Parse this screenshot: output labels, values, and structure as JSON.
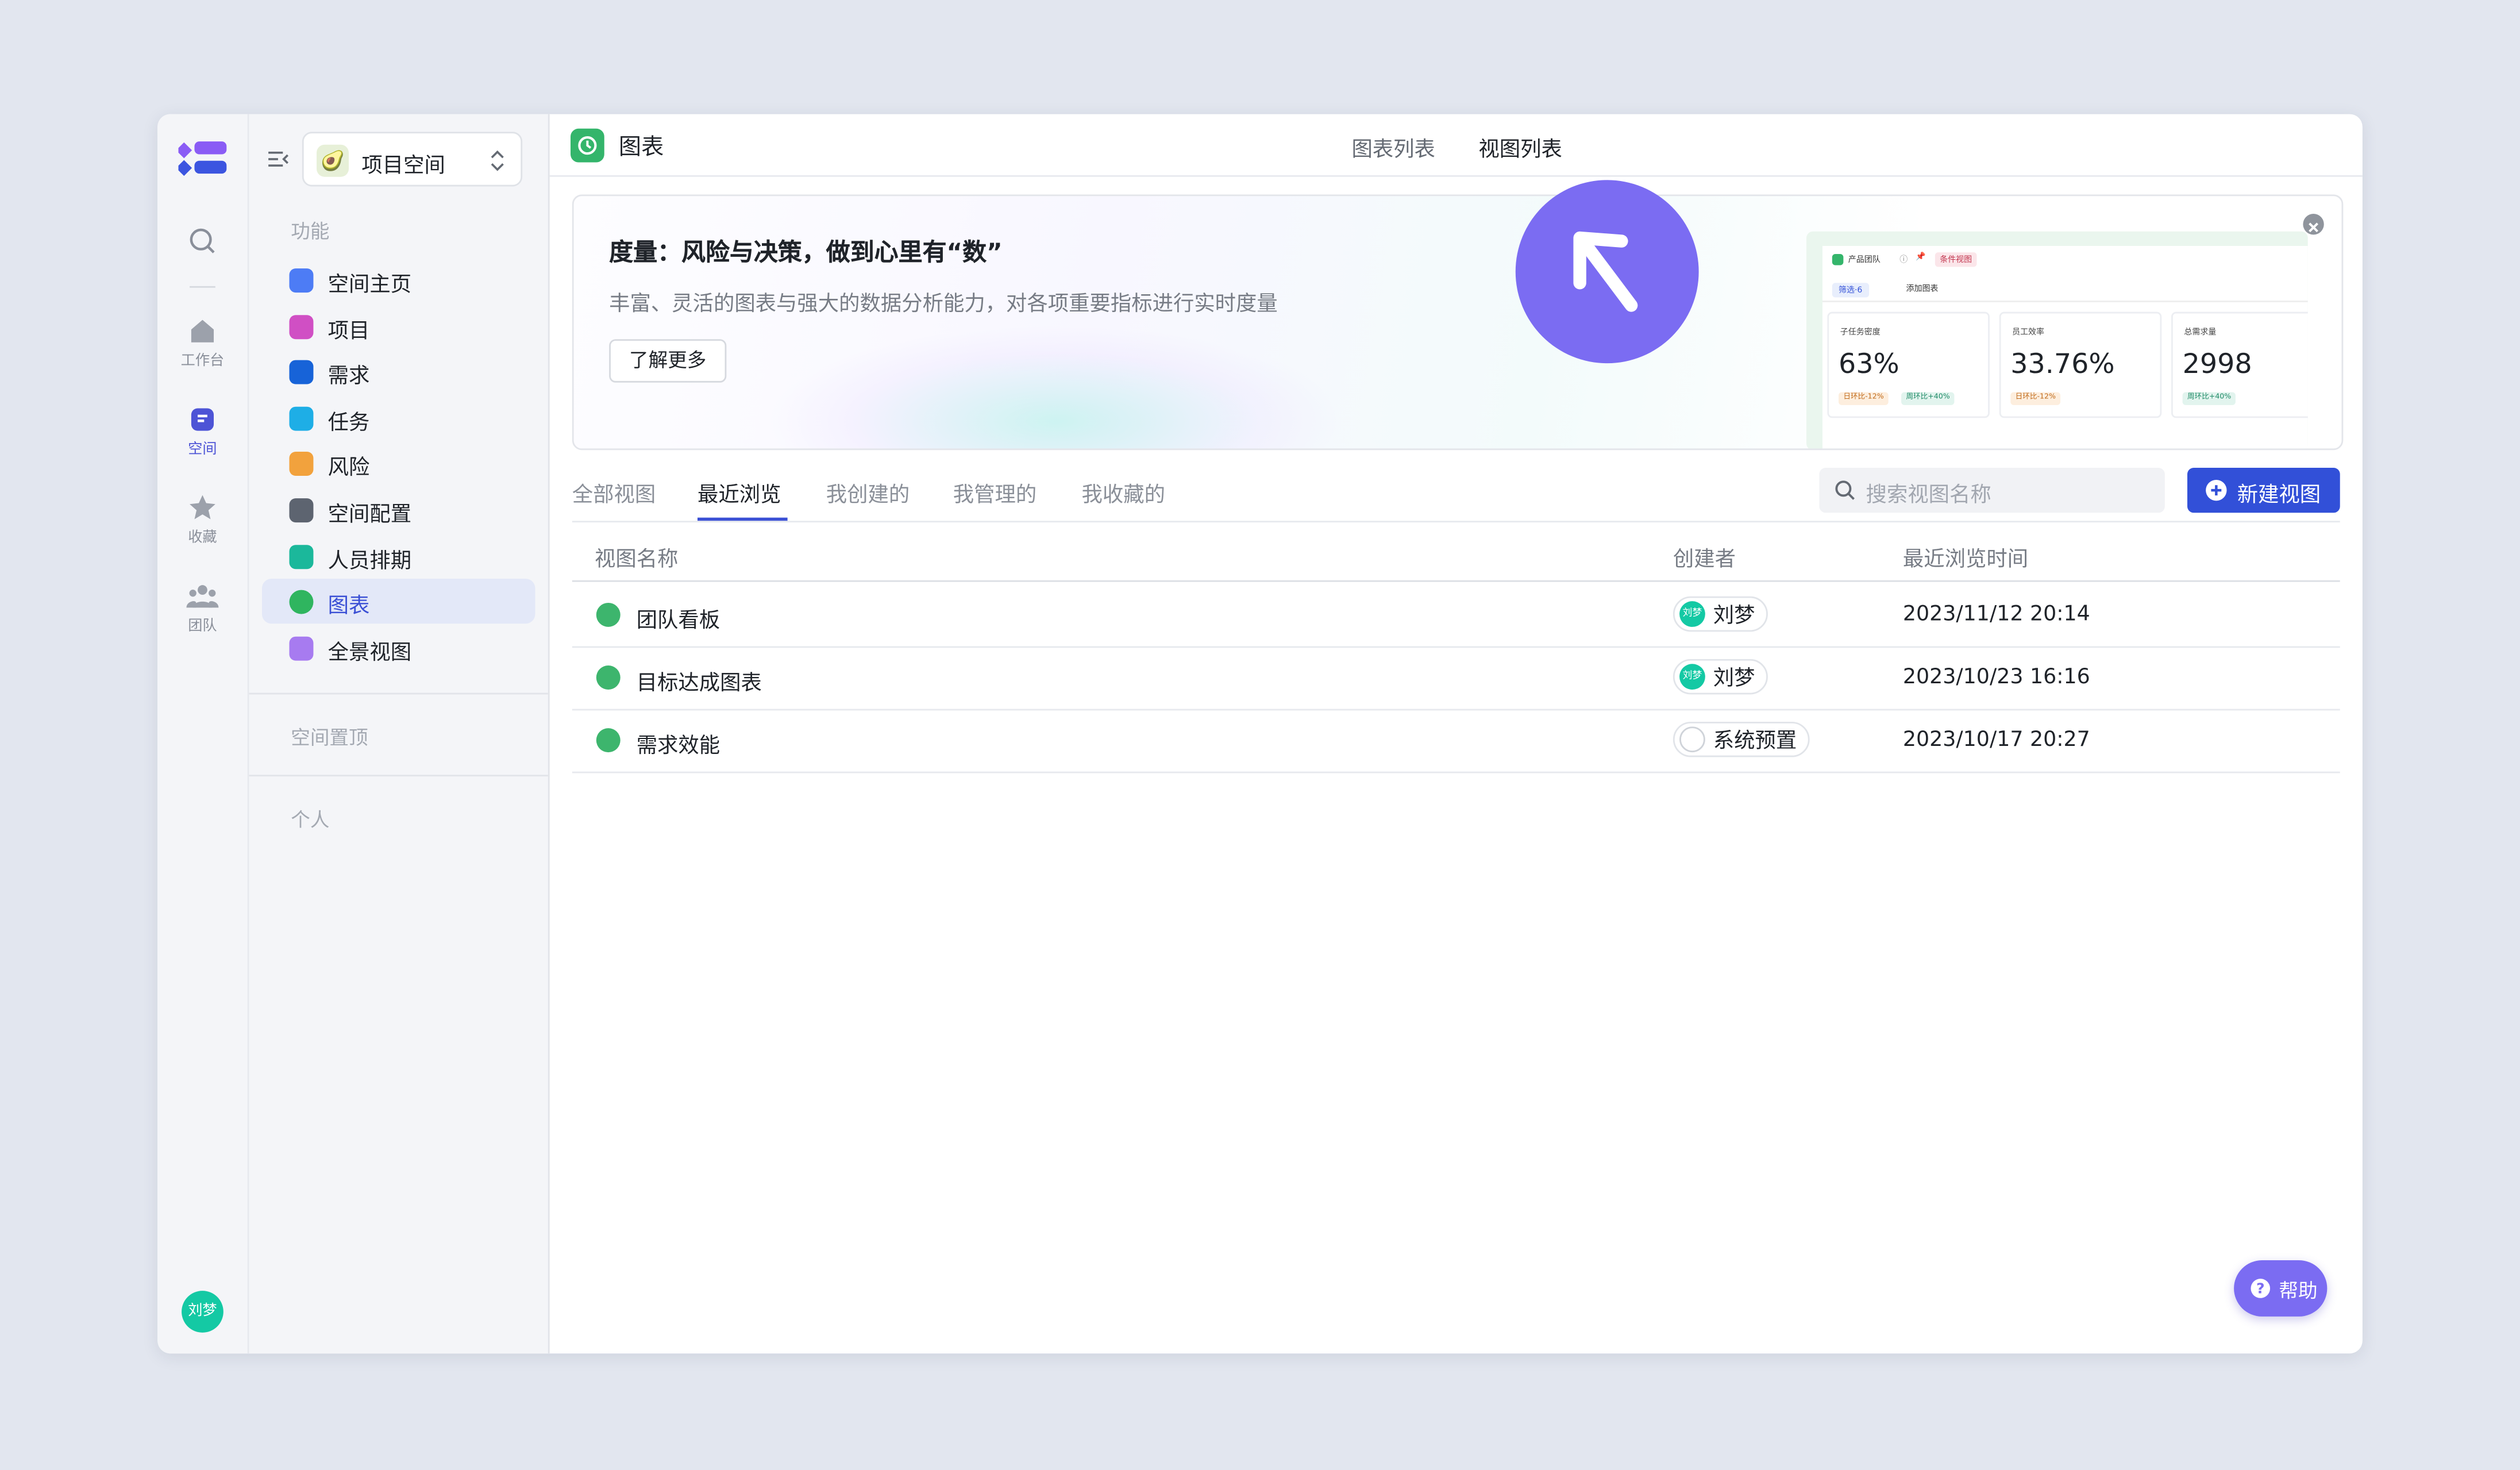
{
  "rail": {
    "items": [
      {
        "label": "工作台",
        "icon": "home-icon"
      },
      {
        "label": "空间",
        "icon": "space-icon"
      },
      {
        "label": "收藏",
        "icon": "star-icon"
      },
      {
        "label": "团队",
        "icon": "team-icon"
      }
    ],
    "avatar": "刘梦",
    "accent": "#4d54d6"
  },
  "sidebar": {
    "space_name": "项目空间",
    "section_features": "功能",
    "items": [
      {
        "label": "空间主页",
        "color": "#4d7cf5"
      },
      {
        "label": "项目",
        "color": "#d04fc4"
      },
      {
        "label": "需求",
        "color": "#1763d8"
      },
      {
        "label": "任务",
        "color": "#1eaee6"
      },
      {
        "label": "风险",
        "color": "#f2a23d"
      },
      {
        "label": "空间配置",
        "color": "#5d6470"
      },
      {
        "label": "人员排期",
        "color": "#1bb89b"
      },
      {
        "label": "图表",
        "color": "#2fb55f"
      },
      {
        "label": "全景视图",
        "color": "#a77bf0"
      }
    ],
    "section_pinned": "空间置顶",
    "section_personal": "个人"
  },
  "header": {
    "title": "图表",
    "tabs": [
      "图表列表",
      "视图列表"
    ],
    "active_tab": "视图列表"
  },
  "banner": {
    "title": "度量：风险与决策，做到心里有“数”",
    "desc": "丰富、灵活的图表与强大的数据分析能力，对各项重要指标进行实时度量",
    "button": "了解更多",
    "preview": {
      "team": "产品团队",
      "tag": "条件视图",
      "filter": "筛选·6",
      "add": "添加图表",
      "cards": [
        {
          "label": "子任务密度",
          "value": "63%",
          "chips": [
            "日环比-12%",
            "周环比+40%"
          ]
        },
        {
          "label": "员工效率",
          "value": "33.76%",
          "chips": [
            "日环比-12%"
          ]
        },
        {
          "label": "总需求量",
          "value": "2998",
          "chips": [
            "周环比+40%"
          ]
        }
      ]
    }
  },
  "view_tabs": [
    "全部视图",
    "最近浏览",
    "我创建的",
    "我管理的",
    "我收藏的"
  ],
  "active_view_tab": "最近浏览",
  "search": {
    "placeholder": "搜索视图名称"
  },
  "new_button": "新建视图",
  "table": {
    "columns": [
      "视图名称",
      "创建者",
      "最近浏览时间"
    ],
    "rows": [
      {
        "name": "团队看板",
        "creator": "刘梦",
        "avatar": "刘梦",
        "time": "2023/11/12 20:14"
      },
      {
        "name": "目标达成图表",
        "creator": "刘梦",
        "avatar": "刘梦",
        "time": "2023/10/23 16:16"
      },
      {
        "name": "需求效能",
        "creator": "系统预置",
        "avatar": "",
        "time": "2023/10/17 20:27"
      }
    ]
  },
  "help": "帮助"
}
